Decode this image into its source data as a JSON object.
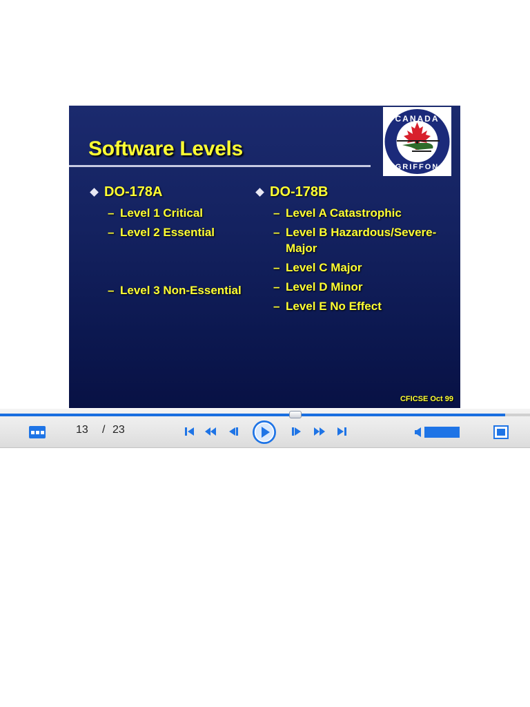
{
  "slide": {
    "title": "Software Levels",
    "logo_text_top": "CANADA",
    "logo_text_bottom": "GRIFFON",
    "columns": [
      {
        "heading": "DO-178A",
        "items": [
          {
            "dash": "–",
            "text": "Level 1 Critical"
          },
          {
            "dash": "–",
            "text": "Level 2 Essential"
          },
          {
            "dash": "–",
            "text": "Level 3 Non-Essential"
          }
        ]
      },
      {
        "heading": "DO-178B",
        "items": [
          {
            "dash": "–",
            "text": "Level A Catastrophic"
          },
          {
            "dash": "–",
            "text": "Level B Hazardous/Severe-Major"
          },
          {
            "dash": "–",
            "text": "Level C Major"
          },
          {
            "dash": "–",
            "text": "Level D Minor"
          },
          {
            "dash": "–",
            "text": "Level E No Effect"
          }
        ]
      }
    ],
    "footer": "CFICSE Oct 99"
  },
  "player": {
    "current_page": "13",
    "separator": "/",
    "total_pages": "23",
    "progress": 0.556,
    "volume": 1.0,
    "accent_color": "#1e74e6",
    "icons": [
      "thumbnails-icon",
      "first-slide-icon",
      "rewind-icon",
      "step-back-icon",
      "play-icon",
      "step-forward-icon",
      "fast-forward-icon",
      "last-slide-icon",
      "volume-icon",
      "fullscreen-icon"
    ]
  }
}
